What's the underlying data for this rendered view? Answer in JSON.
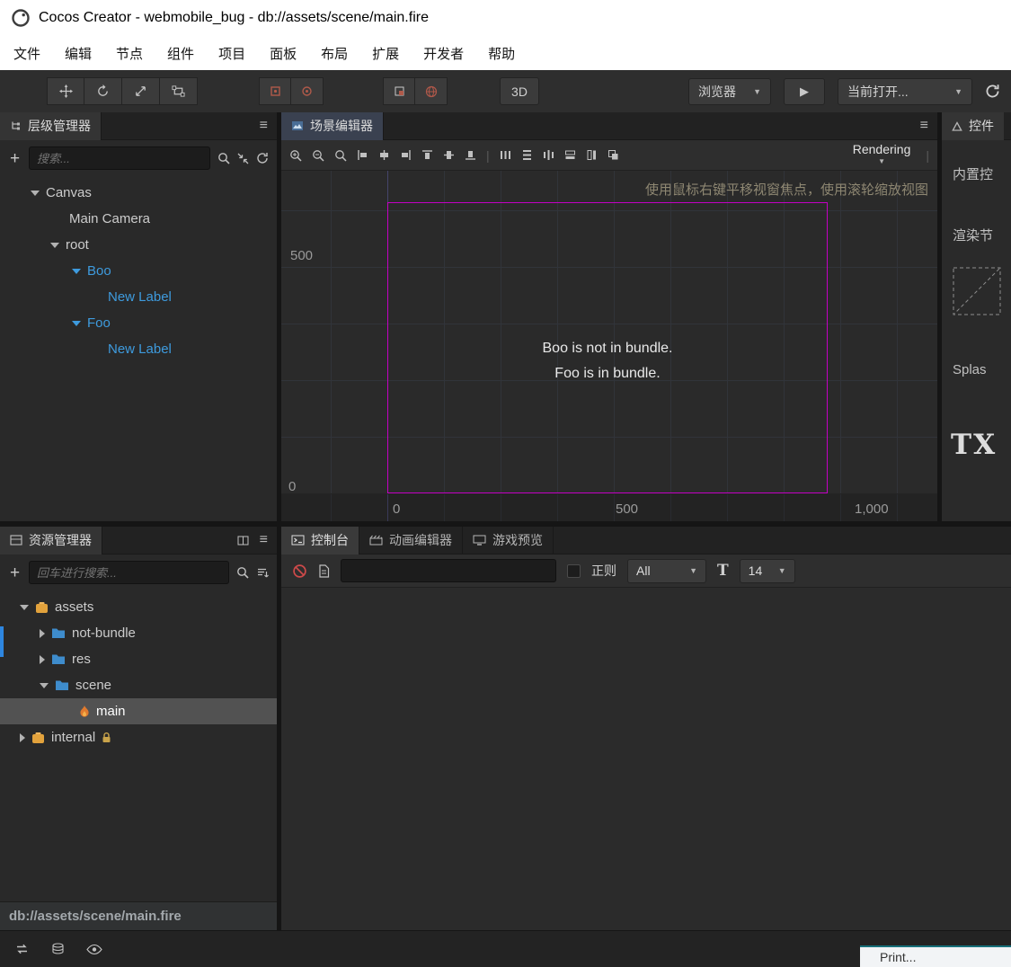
{
  "window": {
    "title": "Cocos Creator - webmobile_bug - db://assets/scene/main.fire"
  },
  "menu": {
    "items": [
      "文件",
      "编辑",
      "节点",
      "组件",
      "项目",
      "面板",
      "布局",
      "扩展",
      "开发者",
      "帮助"
    ]
  },
  "toolbar": {
    "mode_3d": "3D",
    "preview_target": "浏览器",
    "open_scene": "当前打开...",
    "dropdown_caret": "▼",
    "play_glyph": "▶"
  },
  "hierarchy": {
    "title": "层级管理器",
    "search_placeholder": "搜索...",
    "nodes": [
      {
        "label": "Canvas"
      },
      {
        "label": "Main Camera"
      },
      {
        "label": "root"
      },
      {
        "label": "Boo"
      },
      {
        "label": "New Label"
      },
      {
        "label": "Foo"
      },
      {
        "label": "New Label"
      }
    ]
  },
  "scene": {
    "tab": "场景编辑器",
    "rendering": "Rendering",
    "hint": "使用鼠标右键平移视窗焦点，使用滚轮缩放视图",
    "labels": {
      "line1": "Boo is not in bundle.",
      "line2": "Foo is in bundle."
    },
    "ruler": {
      "y500": "500",
      "y0": "0",
      "x0": "0",
      "x500": "500",
      "x1000": "1,000"
    }
  },
  "inspector": {
    "title": "控件",
    "group_builtin": "内置控",
    "group_render": "渲染节",
    "sprite_label": "Splas",
    "text_preview": "TX"
  },
  "assets": {
    "title": "资源管理器",
    "search_placeholder": "回车进行搜索...",
    "nodes": [
      {
        "label": "assets"
      },
      {
        "label": "not-bundle"
      },
      {
        "label": "res"
      },
      {
        "label": "scene"
      },
      {
        "label": "main"
      },
      {
        "label": "internal"
      }
    ],
    "status": "db://assets/scene/main.fire"
  },
  "console": {
    "tabs": [
      "控制台",
      "动画编辑器",
      "游戏预览"
    ],
    "regex_label": "正则",
    "filter_value": "All",
    "font_glyph": "T",
    "font_size": "14"
  },
  "overlay": {
    "text": "Print..."
  },
  "colors": {
    "accent_blue": "#3e9bde",
    "selection_gray": "#525252",
    "canvas_magenta": "#c400c4",
    "folder_blue": "#3e8ccc",
    "bundle_orange": "#e2a23c",
    "fire_orange": "#e07a2e",
    "console_clear_red": "#cf4a4a"
  }
}
